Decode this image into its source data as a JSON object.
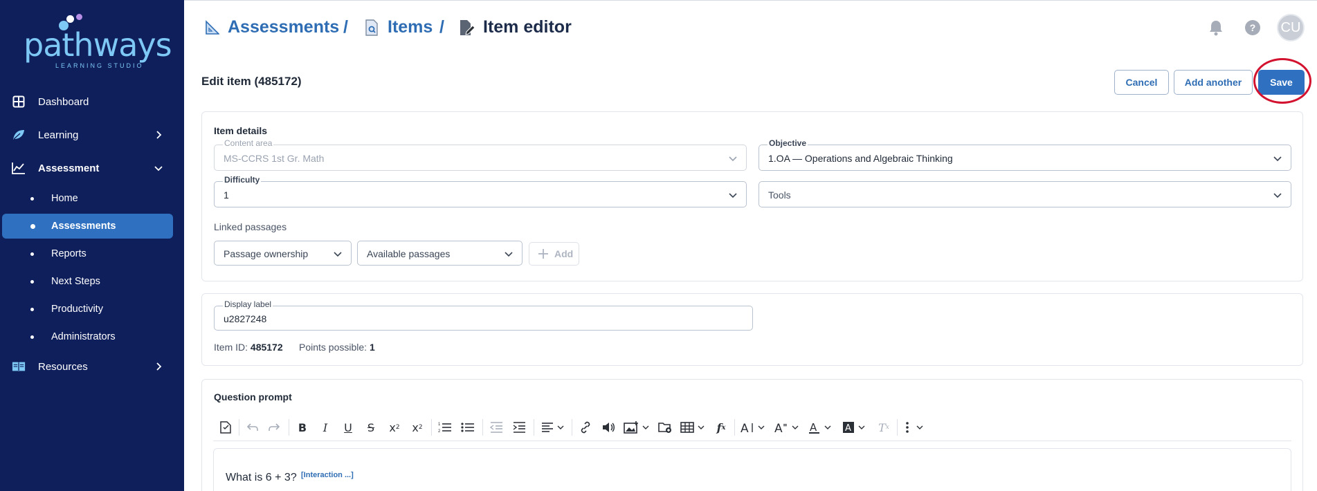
{
  "brand": {
    "name": "pathways",
    "tagline": "LEARNING STUDIO"
  },
  "sidebar": {
    "items": [
      {
        "label": "Dashboard",
        "icon": "grid-icon"
      },
      {
        "label": "Learning",
        "icon": "leaf-icon"
      },
      {
        "label": "Assessment",
        "icon": "chart-icon"
      },
      {
        "label": "Resources",
        "icon": "book-icon"
      }
    ],
    "subitems": [
      "Home",
      "Assessments",
      "Reports",
      "Next Steps",
      "Productivity",
      "Administrators"
    ],
    "active_subitem": "Assessments"
  },
  "breadcrumb": {
    "items": [
      "Assessments",
      "Items",
      "Item editor"
    ],
    "separator": "/"
  },
  "header_icons": [
    "bell-icon",
    "help-icon"
  ],
  "avatar_initials": "CU",
  "page": {
    "title": "Edit item (485172)",
    "buttons": {
      "cancel": "Cancel",
      "add_another": "Add another",
      "save": "Save"
    }
  },
  "item_details": {
    "section_title": "Item details",
    "content_area": {
      "label": "Content area",
      "value": "MS-CCRS 1st Gr. Math"
    },
    "objective": {
      "label": "Objective",
      "value": "1.OA — Operations and Algebraic Thinking"
    },
    "difficulty": {
      "label": "Difficulty",
      "value": "1"
    },
    "tools": {
      "placeholder": "Tools"
    },
    "linked_passages": {
      "label": "Linked passages",
      "ownership": "Passage ownership",
      "available": "Available passages",
      "add": "Add"
    }
  },
  "display": {
    "label": "Display label",
    "value": "u2827248",
    "item_id_label": "Item ID:",
    "item_id": "485172",
    "points_label": "Points possible:",
    "points": "1"
  },
  "question_prompt": {
    "section_title": "Question prompt",
    "text": "What is 6 + 3?",
    "interaction_tag": "[Interaction ...]"
  },
  "colors": {
    "sidebar_bg": "#0f1f5c",
    "accent": "#2f71c0",
    "link": "#2e6db3",
    "highlight": "#d2122e"
  }
}
